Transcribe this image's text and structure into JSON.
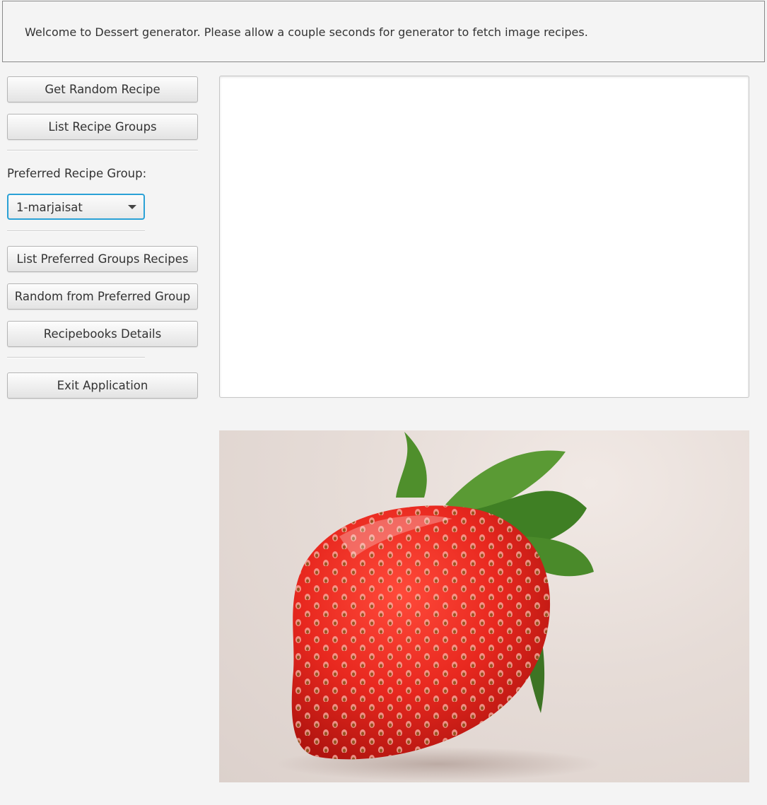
{
  "banner": {
    "message": "Welcome to Dessert generator. Please allow a couple seconds for generator to fetch image recipes."
  },
  "sidebar": {
    "get_random_label": "Get Random Recipe",
    "list_groups_label": "List Recipe Groups",
    "preferred_group_label": "Preferred Recipe Group:",
    "preferred_group_selected": "1-marjaisat",
    "list_preferred_label": "List Preferred Groups Recipes",
    "random_preferred_label": "Random from Preferred Group",
    "recipebooks_label": "Recipebooks Details",
    "exit_label": "Exit Application"
  },
  "output": {
    "text": ""
  },
  "image": {
    "subject": "strawberry",
    "accent_colors": [
      "#e8281f",
      "#4f8f2c",
      "#e6dcd7"
    ]
  }
}
